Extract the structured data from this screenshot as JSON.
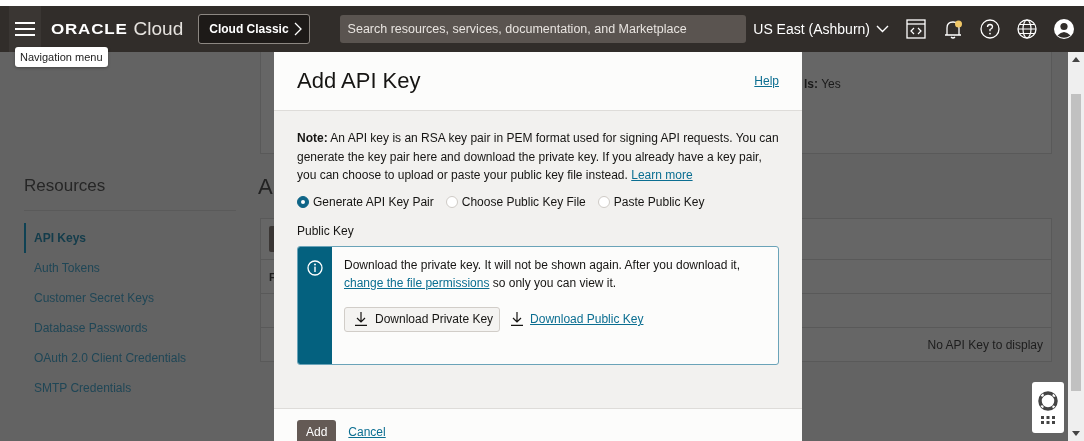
{
  "header": {
    "menu_tooltip": "Navigation menu",
    "logo_brand": "ORACLE",
    "logo_product": "Cloud",
    "classic_button": "Cloud Classic",
    "search": {
      "placeholder": "Search resources, services, documentation, and Marketplace"
    },
    "region": "US East (Ashburn)",
    "notification_unread": true
  },
  "sidebar": {
    "title": "Resources",
    "items": [
      {
        "label": "API Keys",
        "selected": true
      },
      {
        "label": "Auth Tokens",
        "selected": false
      },
      {
        "label": "Customer Secret Keys",
        "selected": false
      },
      {
        "label": "Database Passwords",
        "selected": false
      },
      {
        "label": "OAuth 2.0 Client Credentials",
        "selected": false
      },
      {
        "label": "SMTP Credentials",
        "selected": false
      }
    ]
  },
  "background_page": {
    "detail_label": "ls:",
    "detail_value": "Yes",
    "heading": "A",
    "table_header_cell": "F",
    "empty_message": "No API Key to display"
  },
  "dialog": {
    "title": "Add API Key",
    "help_link": "Help",
    "note": "**Note:** An API key is an RSA key pair in PEM format used for signing API requests. You can generate the key pair here and download the private key. If you already have a key pair, you can choose to upload or paste your public key file instead.",
    "learn_more_link": "Learn more",
    "options": [
      {
        "label": "Generate API Key Pair",
        "selected": true
      },
      {
        "label": "Choose Public Key File",
        "selected": false
      },
      {
        "label": "Paste Public Key",
        "selected": false
      }
    ],
    "public_key_label": "Public Key",
    "info": {
      "text": "Download the private key. It will not be shown again. After you download it,",
      "link": "change the file permissions",
      "text_after": "so only you can view it."
    },
    "download_private_button": "Download Private Key",
    "download_public_link": "Download Public Key",
    "add_button": "Add",
    "cancel_link": "Cancel"
  }
}
